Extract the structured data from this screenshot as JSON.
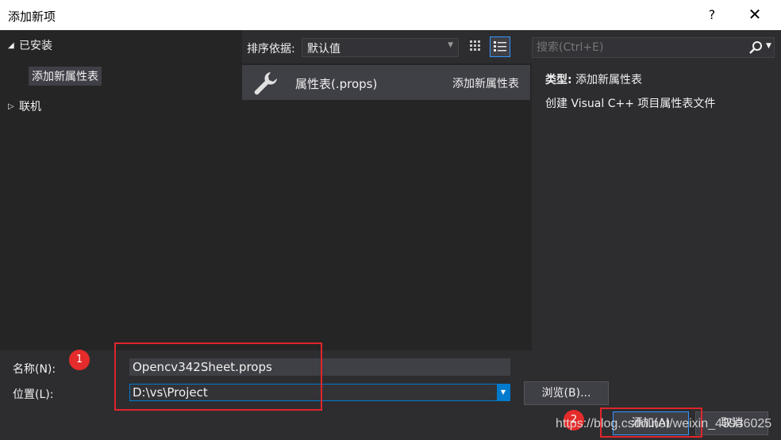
{
  "window": {
    "title": "添加新项",
    "help_label": "?",
    "close_label": "✕"
  },
  "tree": {
    "installed_label": "已安装",
    "installed_expanded_glyph": "◢",
    "child_selected": "添加新属性表",
    "online_label": "联机",
    "online_collapsed_glyph": "▷"
  },
  "sort": {
    "label": "排序依据:",
    "selected": "默认值",
    "views": [
      "grid-view-icon",
      "list-view-icon"
    ]
  },
  "templates": [
    {
      "name": "属性表(.props)",
      "category": "添加新属性表",
      "icon": "wrench-icon"
    }
  ],
  "search": {
    "placeholder": "搜索(Ctrl+E)",
    "icon": "search-icon"
  },
  "details": {
    "type_label": "类型:",
    "type_value": "添加新属性表",
    "description": "创建 Visual C++ 项目属性表文件"
  },
  "form": {
    "name_label": "名称(N):",
    "name_value": "Opencv342Sheet.props",
    "location_label": "位置(L):",
    "location_value": "D:\\vs\\Project",
    "browse_label": "浏览(B)..."
  },
  "buttons": {
    "add_label": "添加(A)",
    "cancel_label": "取消"
  },
  "annotations": {
    "badge_1": "1",
    "badge_2": "2",
    "highlight_color": "#e0242b"
  },
  "watermark": "https://blog.csdn.net/weixin_43936025",
  "colors": {
    "accent": "#007acc",
    "selection_border": "#3399ff",
    "background": "#2d2d30",
    "pane": "#252526"
  }
}
